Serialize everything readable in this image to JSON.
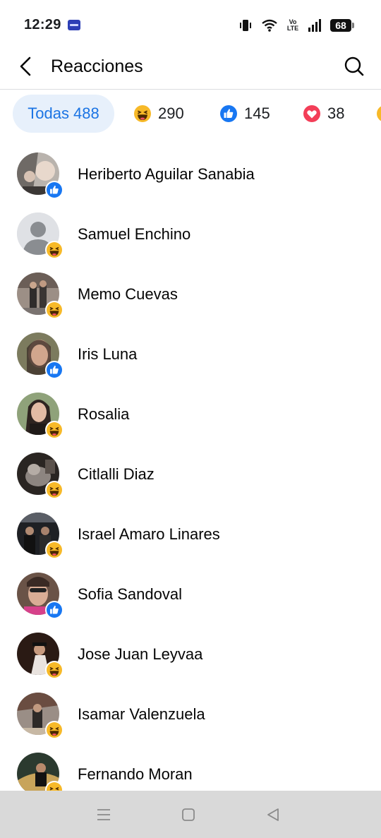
{
  "status_bar": {
    "time": "12:29",
    "volte_top": "Vo",
    "volte_bottom": "LTE",
    "battery": "68"
  },
  "header": {
    "title": "Reacciones",
    "back_icon": "chevron-left-icon",
    "search_icon": "search-icon"
  },
  "filters": [
    {
      "label": "Todas 488",
      "selected": true
    },
    {
      "emoji": "haha",
      "count": "290"
    },
    {
      "emoji": "like",
      "count": "145"
    },
    {
      "emoji": "love",
      "count": "38"
    }
  ],
  "colors": {
    "accent": "#1b74e4",
    "tab_selected_bg": "#e7f0fb",
    "like": "#1877f2",
    "love": "#f33e58",
    "haha": "#f7b928"
  },
  "reactions": [
    {
      "name": "Heriberto Aguilar Sanabia",
      "reaction": "like"
    },
    {
      "name": "Samuel Enchino",
      "reaction": "haha",
      "default_avatar": true
    },
    {
      "name": "Memo Cuevas",
      "reaction": "haha"
    },
    {
      "name": "Iris Luna",
      "reaction": "like"
    },
    {
      "name": "Rosalia",
      "reaction": "haha"
    },
    {
      "name": "Citlalli Diaz",
      "reaction": "haha"
    },
    {
      "name": "Israel Amaro Linares",
      "reaction": "haha"
    },
    {
      "name": "Sofia Sandoval",
      "reaction": "like"
    },
    {
      "name": "Jose Juan Leyvaa",
      "reaction": "haha"
    },
    {
      "name": "Isamar Valenzuela",
      "reaction": "haha"
    },
    {
      "name": "Fernando Moran",
      "reaction": "haha"
    }
  ]
}
